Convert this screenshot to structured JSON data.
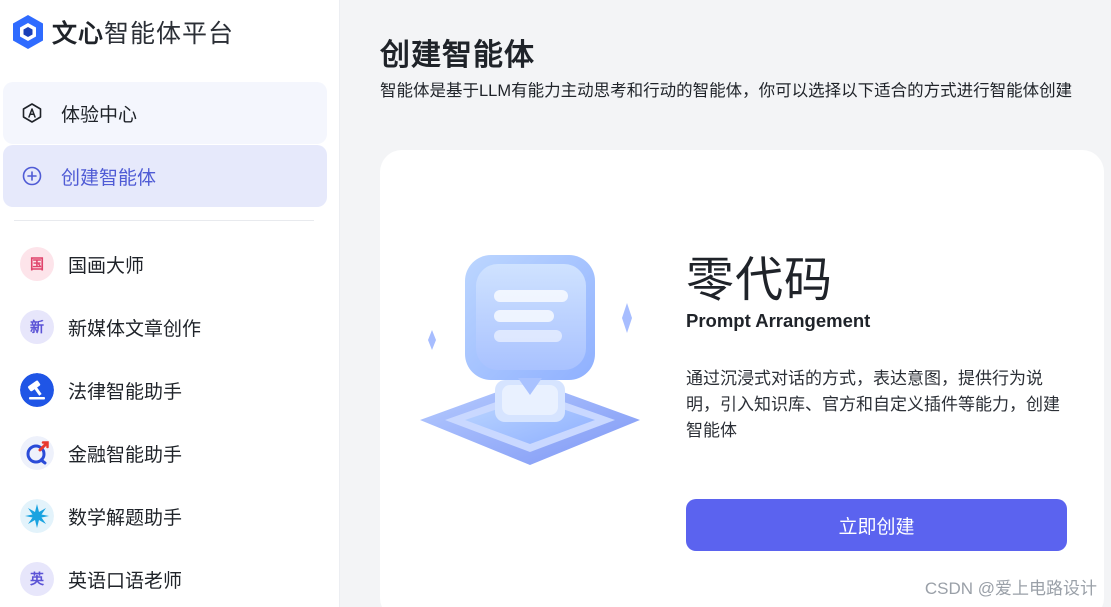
{
  "logo": {
    "strong_text": "文心",
    "light_text": "智能体平台"
  },
  "sidebar": {
    "nav": [
      {
        "label": "体验中心",
        "icon": "experience-icon"
      },
      {
        "label": "创建智能体",
        "icon": "plus-circle-icon"
      }
    ],
    "agents": [
      {
        "label": "国画大师",
        "avatar_text": "国"
      },
      {
        "label": "新媒体文章创作",
        "avatar_text": "新"
      },
      {
        "label": "法律智能助手",
        "avatar_text": ""
      },
      {
        "label": "金融智能助手",
        "avatar_text": ""
      },
      {
        "label": "数学解题助手",
        "avatar_text": ""
      },
      {
        "label": "英语口语老师",
        "avatar_text": "英"
      }
    ]
  },
  "main": {
    "title": "创建智能体",
    "description": "智能体是基于LLM有能力主动思考和行动的智能体，你可以选择以下适合的方式进行智能体创建",
    "card": {
      "title": "零代码",
      "subtitle": "Prompt Arrangement",
      "description": "通过沉浸式对话的方式，表达意图，提供行为说明，引入知识库、官方和自定义插件等能力，创建智能体",
      "button_label": "立即创建"
    }
  },
  "watermark": "CSDN @爱上电路设计",
  "colors": {
    "accent": "#5b63ef",
    "active_nav_bg": "#e6e9fb",
    "active_nav_text": "#4f5bd5"
  }
}
